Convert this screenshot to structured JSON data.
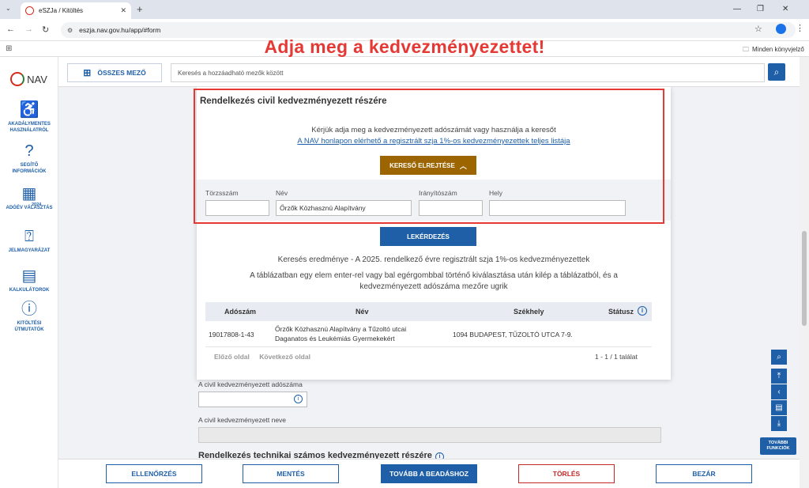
{
  "browser": {
    "tab_title": "eSZJa / Kitöltés",
    "url": "eszja.nav.gov.hu/app/#form",
    "bookmarks_label": "Minden könyvjelző"
  },
  "headline": "Adja meg a kedvezményezettet!",
  "sidebar": {
    "logo_text": "NAV",
    "items": [
      {
        "label": "AKADÁLYMENTES\nHASZNÁLATRÓL",
        "icon": "accessibility-icon"
      },
      {
        "label": "SEGÍTŐ\nINFORMÁCIÓK",
        "icon": "question-icon"
      },
      {
        "label": "ADÓÉV VÁLASZTÁS",
        "icon": "calendar-icon",
        "badge": "2024"
      },
      {
        "label": "JELMAGYARÁZAT",
        "icon": "legend-icon"
      },
      {
        "label": "KALKULÁTOROK",
        "icon": "calculator-icon"
      },
      {
        "label": "KITÖLTÉSI\nÚTMUTATÓK",
        "icon": "guide-icon"
      }
    ]
  },
  "topbar": {
    "all_fields_label": "ÖSSZES MEZŐ",
    "search_placeholder": "Keresés a hozzáadható mezők között"
  },
  "panel": {
    "title": "Rendelkezés civil kedvezményezett részére",
    "prompt": "Kérjük adja meg a kedvezményezett adószámát vagy használja a keresőt",
    "link": "A NAV honlapon elérhető a regisztrált szja 1%-os kedvezményezettek teljes listája",
    "toggle_label": "KERESŐ ELREJTÉSE",
    "filters": {
      "torzsszam_label": "Törzsszám",
      "torzsszam_value": "",
      "nev_label": "Név",
      "nev_value": "Őrzők Közhasznú Alapítvány",
      "irsz_label": "Irányítószám",
      "irsz_value": "",
      "hely_label": "Hely",
      "hely_value": ""
    },
    "query_label": "LEKÉRDEZÉS",
    "result_title": "Keresés eredménye - A 2025. rendelkező évre regisztrált szja 1%-os kedvezményezettek",
    "result_help": "A táblázatban egy elem enter-rel vagy bal egérgombbal történő kiválasztása után kilép a táblázatból, és a kedvezményezett adószáma mezőre ugrik",
    "table": {
      "headers": [
        "Adószám",
        "Név",
        "Székhely",
        "Státusz"
      ],
      "rows": [
        {
          "adoszam": "19017808-1-43",
          "nev1": "Őrzők Közhasznú Alapítvány a Tűzoltó utcai",
          "nev2": "Daganatos és Leukémiás Gyermekekért",
          "szekhely": "1094 BUDAPEST, TŰZOLTÓ UTCA 7-9.",
          "statusz": ""
        }
      ]
    },
    "prev_page": "Előző oldal",
    "next_page": "Következő oldal",
    "count": "1 - 1 / 1 találat"
  },
  "form": {
    "tax_label": "A civil kedvezményezett adószáma",
    "name_label": "A civil kedvezményezett neve",
    "next_section": "Rendelkezés technikai számos kedvezményezett részére"
  },
  "right_tools": {
    "more_label": "TOVÁBBI\nFUNKCIÓK"
  },
  "bottom_bar": {
    "check": "ELLENŐRZÉS",
    "save": "MENTÉS",
    "submit": "TOVÁBB A BEADÁSHOZ",
    "delete": "TÖRLÉS",
    "close": "BEZÁR"
  },
  "colors": {
    "primary": "#1e5fa8",
    "toggle": "#9c6500",
    "highlight": "#e53935",
    "delete": "#c62828"
  }
}
